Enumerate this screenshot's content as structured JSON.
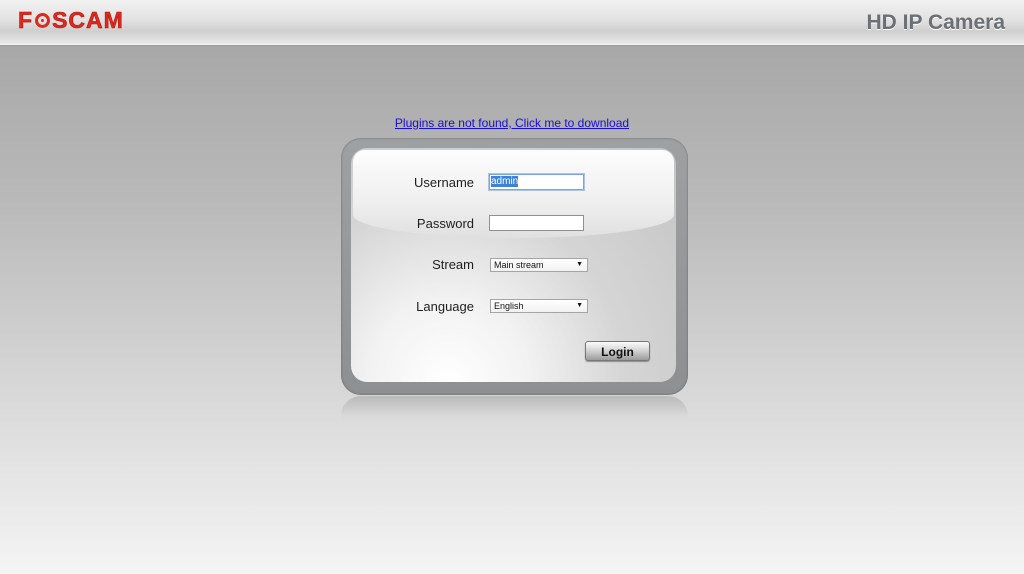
{
  "header": {
    "logo_text": "FOSCAM",
    "logo_prefix": "F",
    "logo_suffix": "SCAM",
    "product_name": "HD IP Camera"
  },
  "plugin_notice": {
    "link_text": "Plugins are not found, Click me to download"
  },
  "login_form": {
    "username": {
      "label": "Username",
      "value": "admin"
    },
    "password": {
      "label": "Password",
      "value": ""
    },
    "stream": {
      "label": "Stream",
      "selected": "Main stream"
    },
    "language": {
      "label": "Language",
      "selected": "English"
    },
    "login_button_label": "Login"
  },
  "colors": {
    "brand_red": "#dd2a1d",
    "link_blue": "#1a0dd6",
    "selection_blue": "#3d82d8"
  },
  "icons": {
    "logo_lens": "camera-lens-icon",
    "dropdown": "chevron-down-icon"
  }
}
